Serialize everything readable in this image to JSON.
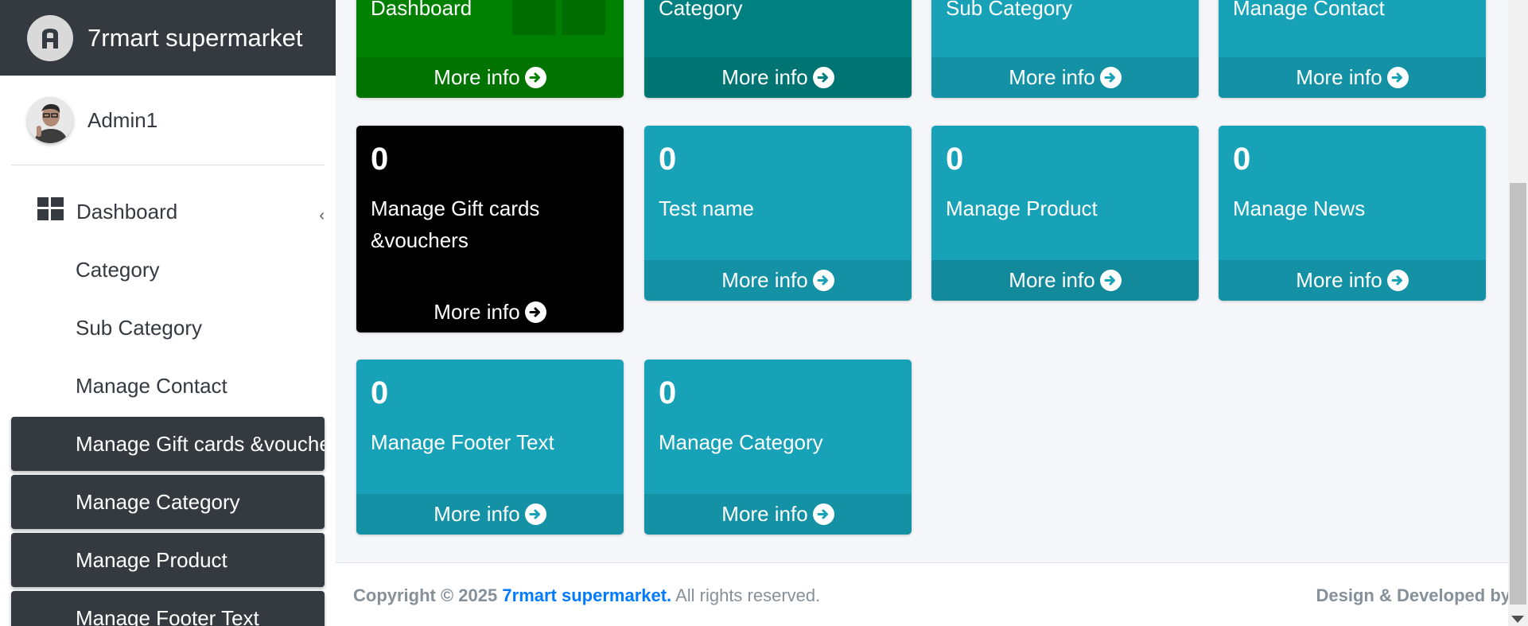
{
  "brand": {
    "name": "7rmart supermarket",
    "logo_icon": "adminlte-logo-icon"
  },
  "user": {
    "name": "Admin1"
  },
  "sidebar": {
    "items": [
      {
        "label": "Dashboard",
        "icon": "dashboard-grid-icon",
        "style": "top"
      },
      {
        "label": "Category",
        "style": "plain"
      },
      {
        "label": "Sub Category",
        "style": "plain"
      },
      {
        "label": "Manage Contact",
        "style": "plain"
      },
      {
        "label": "Manage Gift cards &vouchers",
        "style": "dark"
      },
      {
        "label": "Manage Category",
        "style": "dark"
      },
      {
        "label": "Manage Product",
        "style": "dark"
      },
      {
        "label": "Manage Footer Text",
        "style": "dark"
      }
    ]
  },
  "boxes": {
    "row1": [
      {
        "label": "Dashboard",
        "more": "More info",
        "color": "#008000"
      },
      {
        "label": "Category",
        "more": "More info",
        "color": "#008080"
      },
      {
        "label": "Sub Category",
        "more": "More info",
        "color": "#17a2b8"
      },
      {
        "label": "Manage Contact",
        "more": "More info",
        "color": "#17a2b8"
      }
    ],
    "row2": [
      {
        "count": "0",
        "label": "Manage Gift cards &vouchers",
        "more": "More info",
        "color": "#000000"
      },
      {
        "count": "0",
        "label": "Test name",
        "more": "More info",
        "color": "#17a2b8"
      },
      {
        "count": "0",
        "label": "Manage Product",
        "more": "More info",
        "color": "#17a2b8"
      },
      {
        "count": "0",
        "label": "Manage News",
        "more": "More info",
        "color": "#17a2b8"
      }
    ],
    "row3": [
      {
        "count": "0",
        "label": "Manage Footer Text",
        "more": "More info",
        "color": "#17a2b8"
      },
      {
        "count": "0",
        "label": "Manage Category",
        "more": "More info",
        "color": "#17a2b8"
      }
    ]
  },
  "footer": {
    "copyright_prefix": "Copyright © 2025",
    "copyright_brand": "7rmart supermarket.",
    "copyright_suffix": "All rights reserved.",
    "designed_by": "Design & Developed by"
  }
}
